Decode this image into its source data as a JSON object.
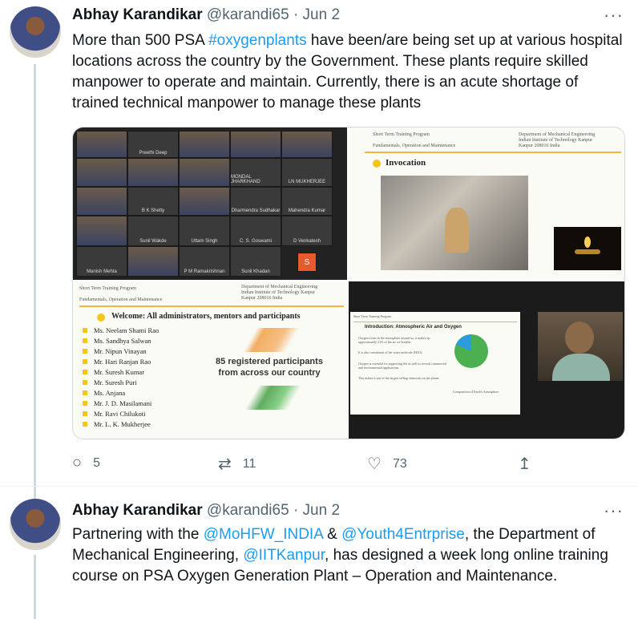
{
  "tweets": [
    {
      "name": "Abhay Karandikar",
      "handle": "@karandi65",
      "date": "· Jun 2",
      "more": "···",
      "text_parts": [
        "More than 500 PSA ",
        "#oxygenplants",
        " have been/are being set up at various hospital locations across the country by the Government. These plants require skilled manpower to operate and maintain. Currently, there is an acute shortage of trained technical manpower to manage these plants"
      ],
      "actions": {
        "replies": "5",
        "retweets": "11",
        "likes": "73"
      }
    },
    {
      "name": "Abhay Karandikar",
      "handle": "@karandi65",
      "date": "· Jun 2",
      "more": "···",
      "text_parts": [
        "Partnering with the ",
        "@MoHFW_INDIA",
        " & ",
        "@Youth4Entrprise",
        ", the Department of Mechanical Engineering, ",
        "@IITKanpur",
        ", has designed a week long online training course on PSA Oxygen Generation Plant – Operation and Maintenance."
      ]
    }
  ],
  "media": {
    "zoom_names": [
      "Preethi Deep",
      "B K Shetty",
      "Sunil Wakde",
      "Uttam Singh",
      "C. S. Goswami",
      "D Venkatesh",
      "Manish Mehta",
      "P M Ramakrishnan",
      "Sunil Khadan",
      "MONDAL JHARKHAND",
      "LN MUKHERJEE",
      "Dharmendra Sudhakar",
      "Mahendra Kumar"
    ],
    "zoom_badge": "S",
    "slide_program": "Short Term Training Program",
    "slide_program_sub": "Fundamentals, Operation and Maintenance",
    "slide_dept": "Department of Mechanical Engineering",
    "slide_inst": "Indian Institute of Technology Kanpur",
    "slide_city": "Kanpur 208016 India",
    "invocation_title": "Invocation",
    "welcome_title": "Welcome: All administrators, mentors and participants",
    "participants": [
      "Ms. Neelam Shami Rao",
      "Ms. Sandhya Salwan",
      "Mr. Nipun Vinayan",
      "Mr. Hari Ranjan Rao",
      "Mr. Suresh Kumar",
      "Mr. Suresh Puri",
      "Ms. Anjana",
      "Mr. J. D. Masilamani",
      "Mr. Ravi Chilukoti",
      "Mr. L. K. Mukherjee"
    ],
    "registered_text": "85 registered participants from across our country",
    "intro_title": "Introduction: Atmospheric Air and Oxygen",
    "intro_points": [
      "Oxygen exists in the atmosphere around us, it makes up approximately 21% of the air we breathe.",
      "It is also constituent of the water molecule (H2O).",
      "Oxygen is essential for supporting life as well as several commercial and environmental applications.",
      "This makes it one of the largest selling chemicals on the planet."
    ],
    "pie_caption": "Composition of Earth's Atmosphere",
    "pie_values": {
      "nitrogen": 78,
      "oxygen": 21
    },
    "colors": {
      "pie_green": "#4caf50",
      "pie_blue": "#2d9cdb",
      "accent_yellow": "#f5c518"
    }
  }
}
